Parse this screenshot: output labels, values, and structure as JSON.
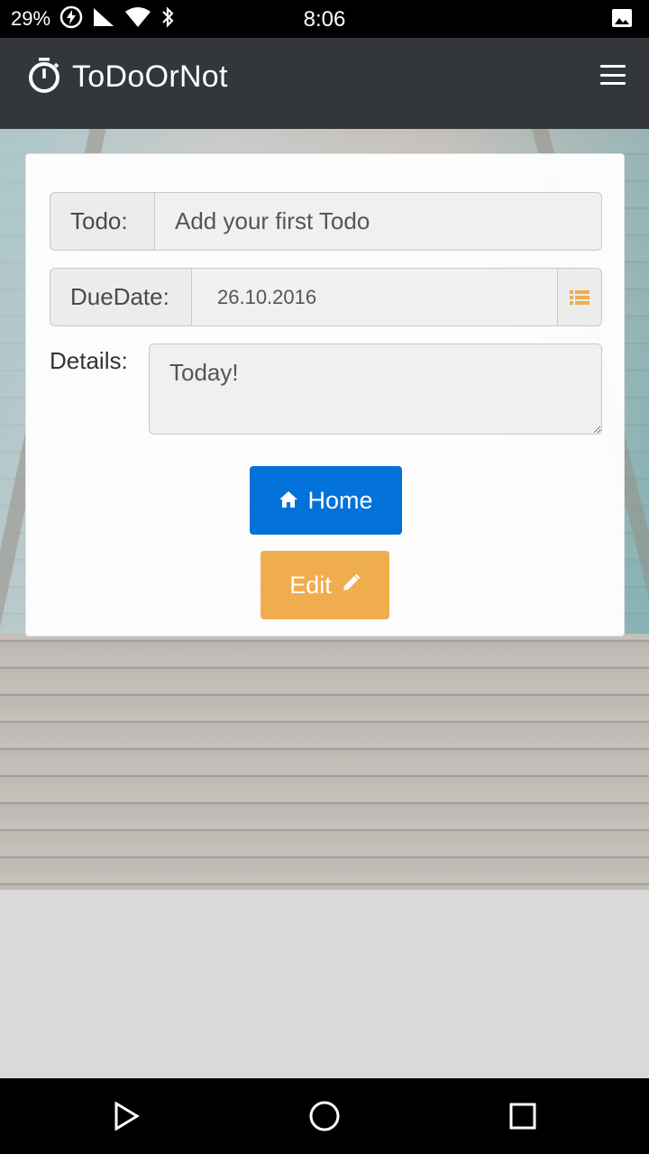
{
  "status_bar": {
    "battery": "29%",
    "time": "8:06"
  },
  "navbar": {
    "title": "ToDoOrNot",
    "brand_icon": "stopwatch-icon",
    "menu_icon": "hamburger-menu-icon"
  },
  "form": {
    "todo_label": "Todo:",
    "todo_placeholder": "Add your first Todo",
    "duedate_label": "DueDate:",
    "duedate_value": "26.10.2016",
    "details_label": "Details:",
    "details_value": "Today!"
  },
  "buttons": {
    "home_label": "Home",
    "edit_label": "Edit"
  },
  "colors": {
    "navbar": "#33373b",
    "home_button": "#0271d9",
    "edit_button": "#f0ad4e"
  }
}
